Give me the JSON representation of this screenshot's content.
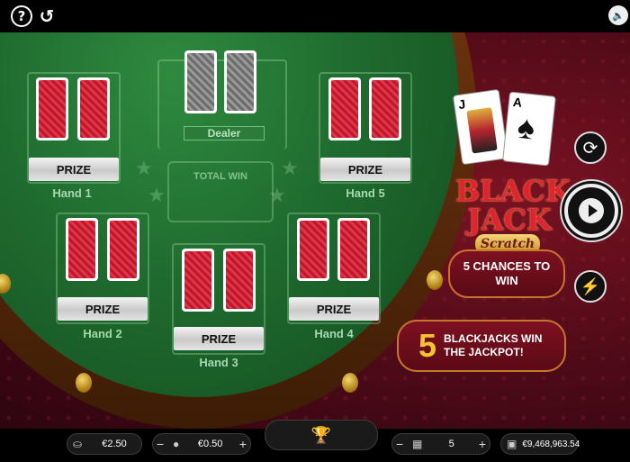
{
  "topbar": {
    "help_icon": "?",
    "history_icon": "↺",
    "sound_icon": "speaker-icon"
  },
  "dealer": {
    "label": "Dealer"
  },
  "total_win": {
    "label": "TOTAL WIN"
  },
  "hands": [
    {
      "label": "Hand 1",
      "prize": "PRIZE"
    },
    {
      "label": "Hand 2",
      "prize": "PRIZE"
    },
    {
      "label": "Hand 3",
      "prize": "PRIZE"
    },
    {
      "label": "Hand 4",
      "prize": "PRIZE"
    },
    {
      "label": "Hand 5",
      "prize": "PRIZE"
    }
  ],
  "logo": {
    "line1": "BLACK",
    "line2": "JACK",
    "line3": "Scratch",
    "card1": "J",
    "card2": "A"
  },
  "promo": {
    "chances": "5 CHANCES TO WIN",
    "jackpot_number": "5",
    "jackpot_text": "BLACKJACKS WIN THE JACKPOT!"
  },
  "bottombar": {
    "bet": "€2.50",
    "coin_value": "€0.50",
    "rounds": "5",
    "balance": "€9,468,963.54",
    "minus": "−",
    "plus": "+"
  },
  "colors": {
    "felt": "#1f6b2f",
    "accent_gold": "#f2c230",
    "card_red": "#c0182b"
  }
}
